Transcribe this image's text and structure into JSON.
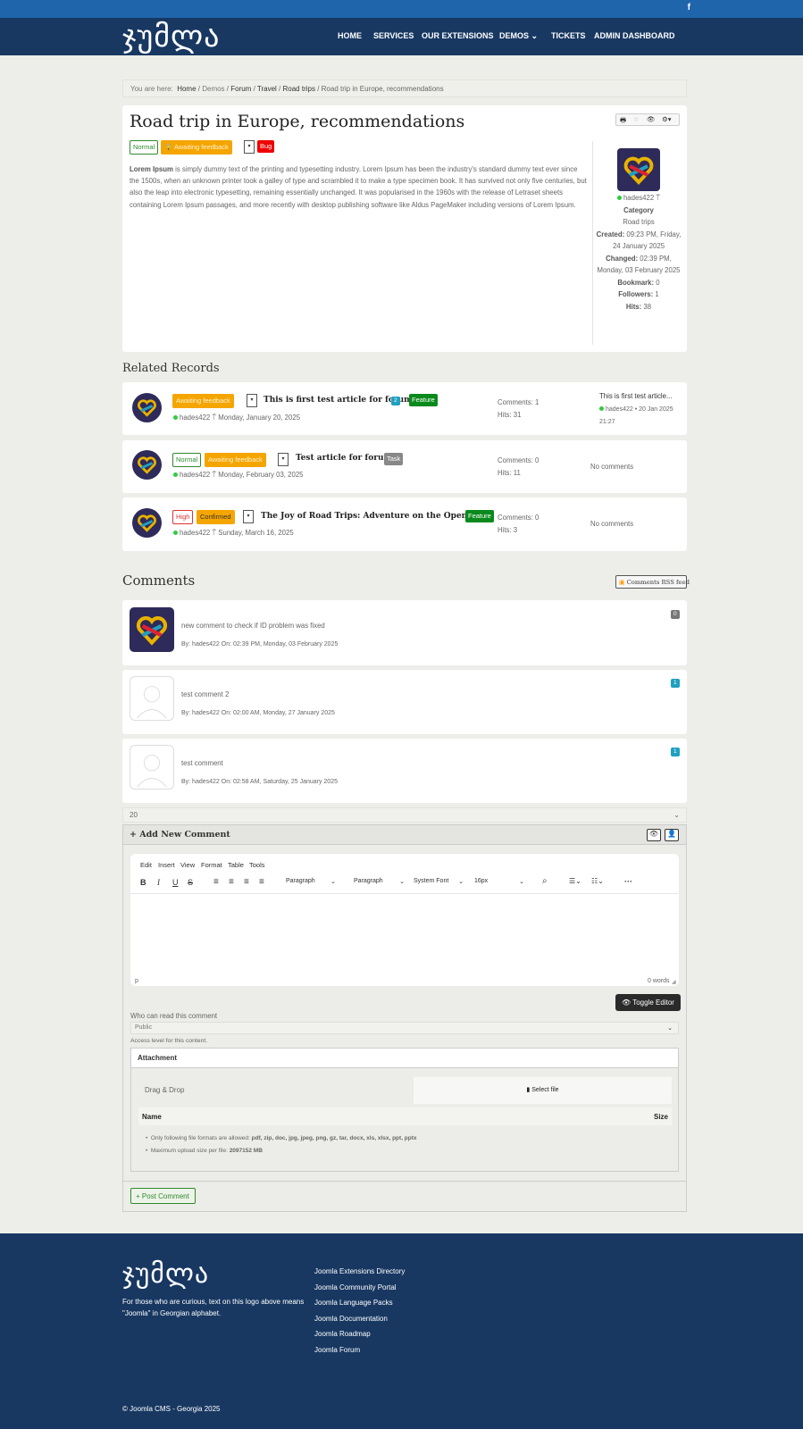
{
  "header": {
    "logo_text": "ჯუმლა",
    "facebook_icon": "f"
  },
  "nav": {
    "items": [
      "HOME",
      "SERVICES",
      "OUR EXTENSIONS",
      "DEMOS",
      "TICKETS",
      "ADMIN DASHBOARD"
    ]
  },
  "breadcrumb": {
    "prefix": "You are here:",
    "items": [
      "Home",
      "Demos",
      "Forum",
      "Travel",
      "Road trips",
      "Road trip in Europe, recommendations"
    ]
  },
  "article": {
    "title": "Road trip in Europe, recommendations",
    "badges": [
      "Normal",
      "Awaiting feedback",
      "Bug"
    ],
    "body_lead": "Lorem Ipsum",
    "body": " is simply dummy text of the printing and typesetting industry. Lorem Ipsum has been the industry's standard dummy text ever since the 1500s, when an unknown printer took a galley of type and scrambled it to make a type specimen book. It has survived not only five centuries, but also the leap into electronic typesetting, remaining essentially unchanged. It was popularised in the 1960s with the release of Letraset sheets containing Lorem Ipsum passages, and more recently with desktop publishing software like Aldus PageMaker including versions of Lorem Ipsum.",
    "sidebar": {
      "author": "hades422",
      "category_label": "Category",
      "category": "Road trips",
      "created_label": "Created:",
      "created": "09:23 PM, Friday, 24 January 2025",
      "changed_label": "Changed:",
      "changed": "02:39 PM, Monday, 03 February 2025",
      "bookmark_label": "Bookmark:",
      "bookmark": "0",
      "followers_label": "Followers:",
      "followers": "1",
      "hits_label": "Hits:",
      "hits": "38"
    }
  },
  "related": {
    "heading": "Related Records",
    "items": [
      {
        "status": "Awaiting feedback",
        "title": "This is first test article for forum",
        "count": "2",
        "type": "Feature",
        "author": "hades422",
        "date": "Monday, January 20, 2025",
        "comments": "Comments: 1",
        "hits": "Hits: 31",
        "last_title": "This is first test article...",
        "last_meta": "hades422 • 20 Jan 2025 21:27"
      },
      {
        "priority": "Normal",
        "status": "Awaiting feedback",
        "title": "Test article for forum",
        "type": "Task",
        "author": "hades422",
        "date": "Monday, February 03, 2025",
        "comments": "Comments: 0",
        "hits": "Hits: 11",
        "last": "No comments"
      },
      {
        "priority": "High",
        "status": "Confirmed",
        "title": "The Joy of Road Trips: Adventure on the Open Road",
        "type": "Feature",
        "author": "hades422",
        "date": "Sunday, March 16, 2025",
        "comments": "Comments: 0",
        "hits": "Hits: 3",
        "last": "No comments"
      }
    ]
  },
  "comments": {
    "heading": "Comments",
    "rss": "Comments RSS feed",
    "items": [
      {
        "text": "new comment to check if ID problem was fixed",
        "meta": "By: hades422 On: 02:39 PM, Monday, 03 February 2025",
        "count": "0"
      },
      {
        "text": "test comment 2",
        "meta": "By: hades422 On: 02:00 AM, Monday, 27 January 2025",
        "count": "1"
      },
      {
        "text": "test comment",
        "meta": "By: hades422 On: 02:58 AM, Saturday, 25 January 2025",
        "count": "1"
      }
    ],
    "page_size": "20"
  },
  "editor": {
    "heading": "Add New Comment",
    "menu": [
      "Edit",
      "Insert",
      "View",
      "Format",
      "Table",
      "Tools"
    ],
    "selects": [
      "Paragraph",
      "Paragraph",
      "System Font",
      "16px"
    ],
    "path": "p",
    "wordcount": "0 words",
    "toggle": "Toggle Editor",
    "access_label": "Who can read this comment",
    "access_value": "Public",
    "access_help": "Access level for this content.",
    "attachment": "Attachment",
    "drag": "Drag & Drop",
    "select_file": "Select file",
    "col_name": "Name",
    "col_size": "Size",
    "formats_label": "Only following file formats are allowed:",
    "formats": "pdf, zip, doc, jpg, jpeg, png, gz, tar, docx, xls, xlsx, ppt, pptx",
    "maxsize_label": "Maximum upload size per file:",
    "maxsize": "2097152 MB",
    "post": "Post Comment"
  },
  "footer": {
    "logo_text": "ჯუმლა",
    "note": "For those who are curious, text on this logo above means \"Joomla\" in Georgian alphabet.",
    "links": [
      "Joomla Extensions Directory",
      "Joomla Community Portal",
      "Joomla Language Packs",
      "Joomla Documentation",
      "Joomla Roadmap",
      "Joomla Forum"
    ],
    "copyright": "© Joomla CMS - Georgia 2025"
  }
}
